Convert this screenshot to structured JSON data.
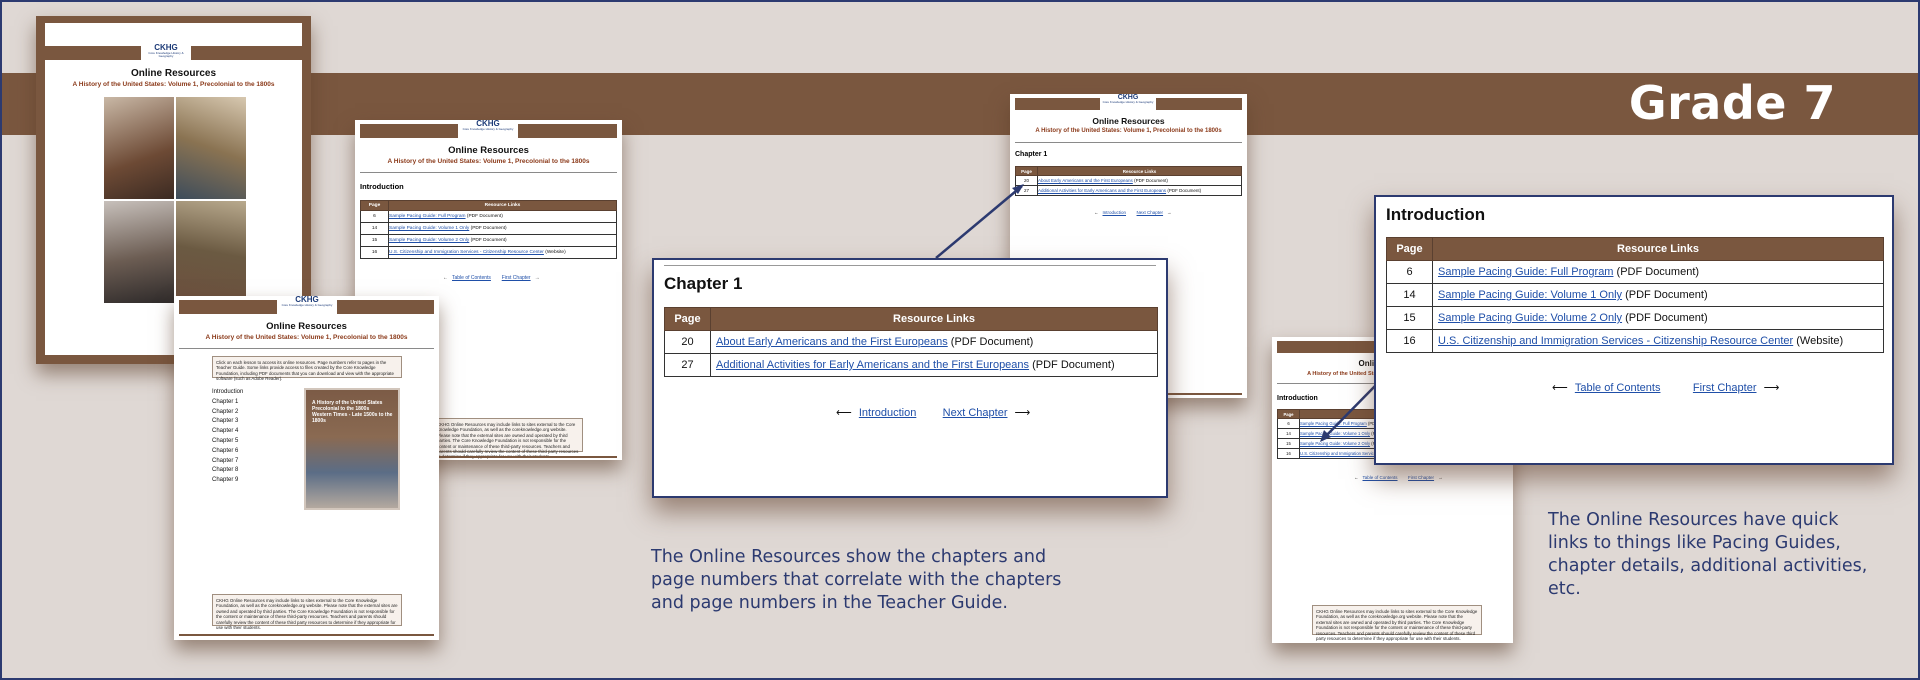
{
  "grade": "Grade 7",
  "doc": {
    "logo": "CKHG",
    "logo_sub": "Core Knowledge History & Geography",
    "title": "Online Resources",
    "subtitle": "A History of the United States: Volume 1, Precolonial to the 1800s"
  },
  "intro": {
    "heading": "Introduction",
    "col_page": "Page",
    "col_links": "Resource Links",
    "rows": [
      {
        "page": "6",
        "link": "Sample Pacing Guide: Full Program",
        "type": "(PDF Document)"
      },
      {
        "page": "14",
        "link": "Sample Pacing Guide: Volume 1 Only",
        "type": "(PDF Document)"
      },
      {
        "page": "15",
        "link": "Sample Pacing Guide: Volume 2 Only",
        "type": "(PDF Document)"
      },
      {
        "page": "16",
        "link": "U.S. Citizenship and Immigration Services - Citizenship Resource Center",
        "type": "(Website)"
      }
    ],
    "nav_prev": "Table of Contents",
    "nav_next": "First Chapter"
  },
  "chapter1": {
    "heading": "Chapter 1",
    "col_page": "Page",
    "col_links": "Resource Links",
    "rows": [
      {
        "page": "20",
        "link": "About Early Americans and the First Europeans",
        "type": "(PDF Document)"
      },
      {
        "page": "27",
        "link": "Additional Activities for Early Americans and the First Europeans",
        "type": "(PDF Document)"
      }
    ],
    "nav_prev": "Introduction",
    "nav_next": "Next Chapter"
  },
  "toc": {
    "instructions": "Click on each lesson to access its online resources. Page numbers refer to pages in the Teacher Guide. Some links provide access to files created by the Core Knowledge Foundation, including PDF documents that you can download and view with the appropriate software (such as Adobe Reader).",
    "items": [
      "Introduction",
      "Chapter 1",
      "Chapter 2",
      "Chapter 3",
      "Chapter 4",
      "Chapter 5",
      "Chapter 6",
      "Chapter 7",
      "Chapter 8",
      "Chapter 9"
    ],
    "book_title": "A History of the United States",
    "book_sub1": "Precolonial to the 1800s",
    "book_sub2": "Western Times - Late 1500s to the 1800s"
  },
  "notice": "CKHG Online Resources may include links to sites external to the Core Knowledge Foundation, as well as the coreknowledge.org website. Please note that the external sites are owned and operated by third parties. The Core Knowledge Foundation is not responsible for the content or maintenance of these third-party resources. Teachers and parents should carefully review the content of these third party resources to determine if they appropriate for use with their students.",
  "captions": {
    "center": "The Online Resources show the chapters and page numbers that correlate with the chapters and page numbers in the Teacher Guide.",
    "right": "The Online Resources have quick links to things like Pacing Guides, chapter details, additional activities, etc."
  },
  "colors": {
    "band": "#7a573f",
    "accent": "#2c3a70",
    "link": "#1f4fa8",
    "subtitle": "#8b3a1a"
  }
}
